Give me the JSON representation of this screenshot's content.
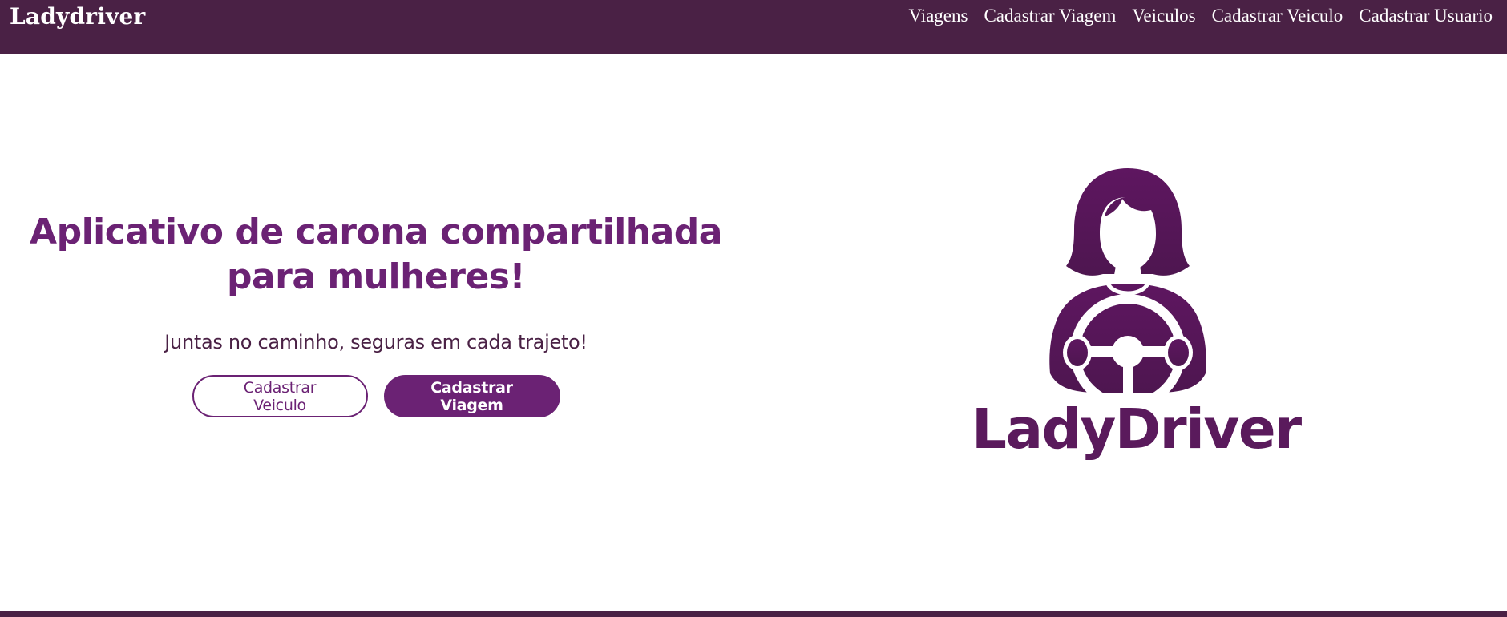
{
  "navbar": {
    "brand": "Ladydriver",
    "links": [
      {
        "label": "Viagens"
      },
      {
        "label": "Cadastrar Viagem"
      },
      {
        "label": "Veiculos"
      },
      {
        "label": "Cadastrar Veiculo"
      },
      {
        "label": "Cadastrar Usuario"
      }
    ]
  },
  "hero": {
    "title": "Aplicativo de carona compartilhada para mulheres!",
    "subtitle": "Juntas no caminho, seguras em cada trajeto!",
    "buttons": {
      "primary_outline": "Cadastrar Veiculo",
      "primary_solid": "Cadastrar Viagem"
    }
  },
  "logo": {
    "wordmark": "LadyDriver",
    "icon": "woman-driver-steering-wheel-icon"
  },
  "colors": {
    "navbar_bg": "#4a2145",
    "accent": "#6b2274",
    "logo_purple": "#5a1a5c",
    "background": "#ffffff"
  }
}
